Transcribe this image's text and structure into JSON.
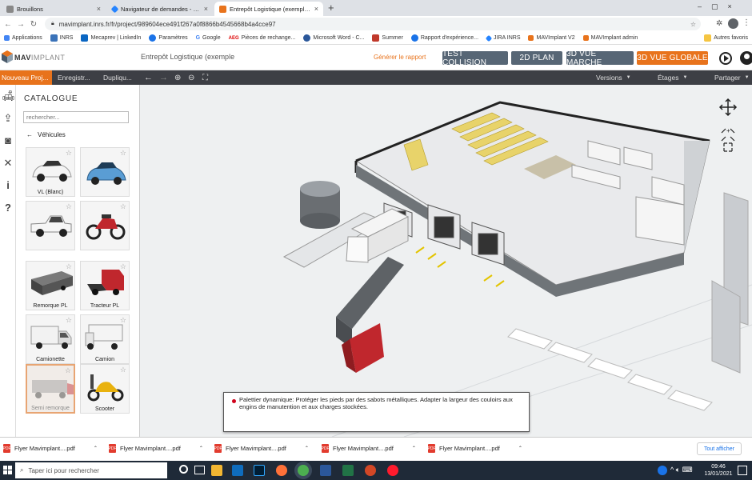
{
  "browser": {
    "tabs": [
      {
        "title": "Brouillons",
        "active": false
      },
      {
        "title": "Navigateur de demandes - JIRA INRS",
        "active": false
      },
      {
        "title": "Entrepôt Logistique (exemple) - MAVImplant",
        "active": true
      }
    ],
    "new_tab": "+",
    "url": "mavimplant.inrs.fr/fr/project/989604ece491f267a0f8866b4545668b4a4cce97",
    "bookmarks": [
      "Applications",
      "INRS",
      "Mecaprev | LinkedIn",
      "Paramètres",
      "Google",
      "Pièces de rechange...",
      "Microsoft Word - C...",
      "Summer",
      "Rapport d'expérience...",
      "JIRA INRS",
      "MAVImplant V2",
      "MAVImplant admin"
    ],
    "other_favorites": "Autres favoris"
  },
  "app": {
    "logo": "MAVIMPLANT",
    "logo_mav": "MAV",
    "logo_rest": "IMPLANT",
    "project_name": "Entrepôt Logistique (exemple",
    "report_link": "Générer le rapport",
    "view_buttons": [
      "TEST COLLISION",
      "2D PLAN",
      "3D VUE MARCHE",
      "3D VUE GLOBALE"
    ],
    "toolbar": {
      "new_project": "Nouveau Proj...",
      "save": "Enregistr...",
      "duplicate": "Dupliqu...",
      "versions": "Versions",
      "floors": "Étages",
      "share": "Partager"
    }
  },
  "catalogue": {
    "title": "CATALOGUE",
    "search_placeholder": "rechercher...",
    "category": "Véhicules",
    "items": [
      {
        "label": "VL (Blanc)"
      },
      {
        "label": ""
      },
      {
        "label": ""
      },
      {
        "label": ""
      },
      {
        "label": "Remorque PL"
      },
      {
        "label": "Tracteur PL"
      },
      {
        "label": "Camionette"
      },
      {
        "label": "Camion"
      },
      {
        "label": "Semi remorque"
      },
      {
        "label": "Scooter"
      }
    ]
  },
  "tooltip": {
    "text": "Palettier dynamique: Protéger les pieds par des sabots métalliques. Adapter la largeur des couloirs aux engins de manutention et aux charges stockées."
  },
  "downloads": {
    "items": [
      "Flyer Mavimplant....pdf",
      "Flyer Mavimplant....pdf",
      "Flyer Mavimplant....pdf",
      "Flyer Mavimplant....pdf",
      "Flyer Mavimplant....pdf"
    ],
    "show_all": "Tout afficher"
  },
  "taskbar": {
    "search_placeholder": "Taper ici pour rechercher",
    "time": "09:46",
    "date": "13/01/2021"
  },
  "colors": {
    "accent_orange": "#e8731c",
    "view_button": "#576675",
    "toolbar_bg": "#3d3f45",
    "taskbar_bg": "#1f2a38"
  }
}
